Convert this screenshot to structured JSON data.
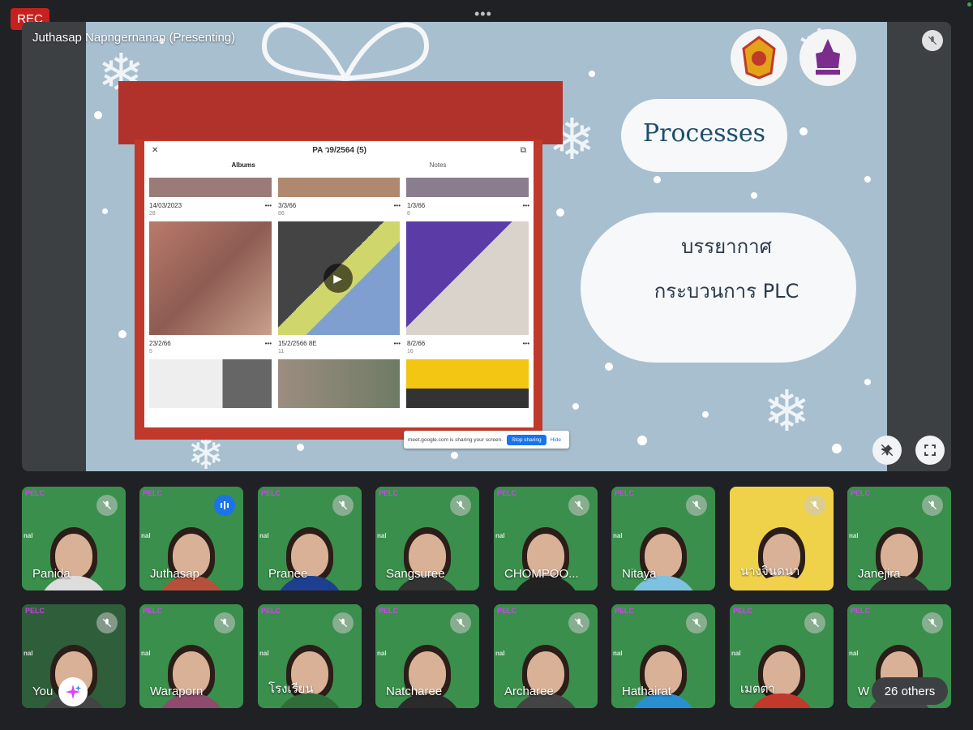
{
  "recording": {
    "label": "REC"
  },
  "presenter": {
    "name_label": "Juthasap Napngernanan (Presenting)"
  },
  "slide": {
    "title": "Processes",
    "body_line1": "บรรยากาศ",
    "body_line2": "กระบวนการ PLC",
    "album": {
      "title": "PA ว9/2564 (5)",
      "tabs": [
        "Albums",
        "Notes"
      ],
      "captions": [
        {
          "date": "14/03/2023",
          "count": "28"
        },
        {
          "date": "3/3/66",
          "count": "86"
        },
        {
          "date": "1/3/66",
          "count": "8"
        },
        {
          "date": "23/2/66",
          "count": "5"
        },
        {
          "date": "15/2/2566 8E",
          "count": "11"
        },
        {
          "date": "8/2/66",
          "count": "16"
        }
      ]
    },
    "share_bar": {
      "message": "meet.google.com is sharing your screen.",
      "stop_label": "Stop sharing",
      "hide_label": "Hide"
    }
  },
  "participants": [
    {
      "name": "Panida",
      "mic": "muted"
    },
    {
      "name": "Juthasap",
      "mic": "speaking"
    },
    {
      "name": "Pranee",
      "mic": "muted"
    },
    {
      "name": "Sangsuree",
      "mic": "muted"
    },
    {
      "name": "CHOMPOO...",
      "mic": "muted"
    },
    {
      "name": "Nitaya",
      "mic": "muted"
    },
    {
      "name": "นางจินดนา",
      "mic": "muted"
    },
    {
      "name": "Janejira",
      "mic": "muted"
    },
    {
      "name": "You",
      "mic": "muted"
    },
    {
      "name": "Waraporn",
      "mic": "muted"
    },
    {
      "name": "โรงเรียน",
      "mic": "muted"
    },
    {
      "name": "Natcharee",
      "mic": "muted"
    },
    {
      "name": "Archaree",
      "mic": "muted"
    },
    {
      "name": "Hathairat",
      "mic": "muted"
    },
    {
      "name": "เมตตา",
      "mic": "muted"
    },
    {
      "name": "W",
      "mic": "muted"
    }
  ],
  "others": {
    "label": "26 others"
  },
  "background_text": {
    "brand": "PELC",
    "side": "nal"
  },
  "colors": {
    "rec": "#c5221f",
    "tile_bg": "#3a8f4c",
    "accent": "#1a73e8",
    "slide_bg": "#a8bfcf"
  },
  "icons": [
    "mic-off-icon",
    "mic-speaking-icon",
    "pin-off-icon",
    "fullscreen-icon",
    "more-icon",
    "sparkle-icon",
    "close-icon"
  ]
}
